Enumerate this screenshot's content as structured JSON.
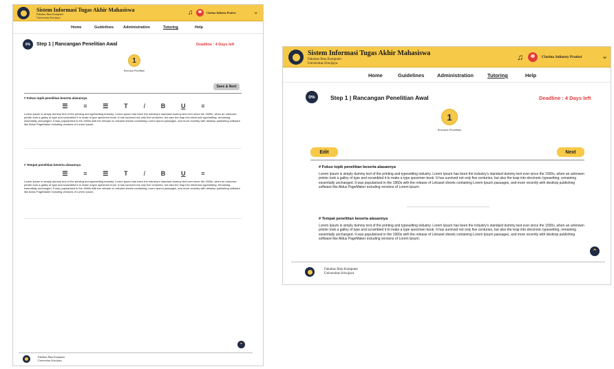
{
  "app": {
    "title": "Sistem Informasi Tugas Akhir Mahasiswa",
    "faculty": "Fakultas Ilmu Komputer",
    "university": "Universitas Sriwijaya"
  },
  "user": {
    "name": "Clarina Juliatsty Pratiwi"
  },
  "nav": [
    "Home",
    "Guidelines",
    "Administration",
    "Tutoring",
    "Help"
  ],
  "nav_active": "Tutoring",
  "step": {
    "progress": "0%",
    "title": "Step 1 | Rancangan Penelitian Awal",
    "deadline": "Deadline : 4 Days left",
    "number": "1",
    "label": "Rencana Penelitian"
  },
  "buttons": {
    "edit": "Edit",
    "next": "Next",
    "save_next": "Save & Next"
  },
  "toolbar": {
    "align_left": "☰",
    "align_center": "≡",
    "align_right": "☰",
    "text": "T",
    "italic": "I",
    "bold": "B",
    "underline": "U",
    "strike": "≡"
  },
  "sections": [
    {
      "heading": "# Fokus topik penelitian beserta alasannya",
      "body": "Lorem Ipsum is simply dummy text of the printing and typesetting industry. Lorem Ipsum has been the industry's standard dummy text ever since the 1500s, when an unknown printer took a galley of type and scrambled it to make a type specimen book. It has survived not only five centuries, but also the leap into electronic typesetting, remaining essentially unchanged. It was popularised in the 1960s with the release of Letraset sheets containing Lorem Ipsum passages, and more recently with desktop publishing software like Aldus PageMaker including versions of Lorem Ipsum."
    },
    {
      "heading": "# Tempat penelitian beserta alasannya",
      "body": "Lorem Ipsum is simply dummy text of the printing and typesetting industry. Lorem Ipsum has been the industry's standard dummy text ever since the 1500s, when an unknown printer took a galley of type and scrambled it to make a type specimen book. It has survived not only five centuries, but also the leap into electronic typesetting, remaining essentially unchanged. It was popularised in the 1960s with the release of Letraset sheets containing Lorem Ipsum passages, and more recently with desktop publishing software like Aldus PageMaker including versions of Lorem Ipsum."
    }
  ],
  "colors": {
    "accent": "#f7c948",
    "navy": "#1f2a44",
    "deadline": "#e2383a"
  },
  "icons": {
    "bell": "bell-icon",
    "chevron": "chevron-down-icon",
    "scroll_top": "scroll-top-icon"
  }
}
